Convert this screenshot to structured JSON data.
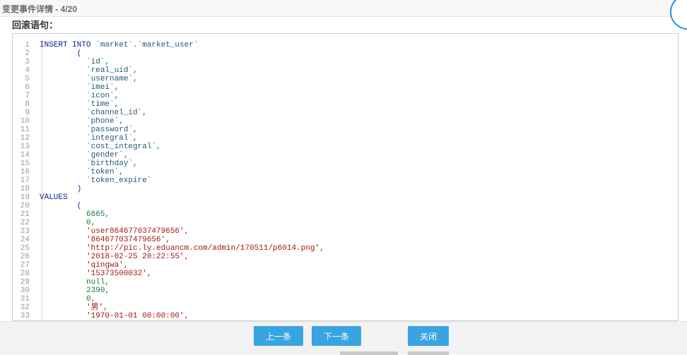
{
  "dialog": {
    "title": "变更事件详情 - 4/20",
    "section_label": "回滚语句："
  },
  "code": {
    "lines": [
      [
        {
          "t": "INSERT INTO ",
          "c": "kw"
        },
        {
          "t": "`market`.`market_user`",
          "c": "id"
        }
      ],
      [
        {
          "t": "        (",
          "c": "kw"
        }
      ],
      [
        {
          "t": "          `id`,",
          "c": "id"
        }
      ],
      [
        {
          "t": "          `real_uid`,",
          "c": "id"
        }
      ],
      [
        {
          "t": "          `username`,",
          "c": "id"
        }
      ],
      [
        {
          "t": "          `imei`,",
          "c": "id"
        }
      ],
      [
        {
          "t": "          `icon`,",
          "c": "id"
        }
      ],
      [
        {
          "t": "          `time`,",
          "c": "id"
        }
      ],
      [
        {
          "t": "          `channel_id`,",
          "c": "id"
        }
      ],
      [
        {
          "t": "          `phone`,",
          "c": "id"
        }
      ],
      [
        {
          "t": "          `password`,",
          "c": "id"
        }
      ],
      [
        {
          "t": "          `integral`,",
          "c": "id"
        }
      ],
      [
        {
          "t": "          `cost_integral`,",
          "c": "id"
        }
      ],
      [
        {
          "t": "          `gender`,",
          "c": "id"
        }
      ],
      [
        {
          "t": "          `birthday`,",
          "c": "id"
        }
      ],
      [
        {
          "t": "          `token`,",
          "c": "id"
        }
      ],
      [
        {
          "t": "          `token_expire`",
          "c": "id"
        }
      ],
      [
        {
          "t": "        )",
          "c": "kw"
        }
      ],
      [
        {
          "t": "VALUES",
          "c": "kw"
        }
      ],
      [
        {
          "t": "        (",
          "c": "kw"
        }
      ],
      [
        {
          "t": "          6865,",
          "c": "num"
        }
      ],
      [
        {
          "t": "          0,",
          "c": "num"
        }
      ],
      [
        {
          "t": "          'user864677037479656',",
          "c": "str"
        }
      ],
      [
        {
          "t": "          '864677037479656',",
          "c": "str"
        }
      ],
      [
        {
          "t": "          'http://pic.ly.eduancm.com/admin/170511/p6014.png',",
          "c": "str"
        }
      ],
      [
        {
          "t": "          '2018-02-25 20:22:55',",
          "c": "str"
        }
      ],
      [
        {
          "t": "          'qingwa',",
          "c": "str"
        }
      ],
      [
        {
          "t": "          '15373500032',",
          "c": "str"
        }
      ],
      [
        {
          "t": "          null,",
          "c": "num"
        }
      ],
      [
        {
          "t": "          2390,",
          "c": "num"
        }
      ],
      [
        {
          "t": "          0,",
          "c": "num"
        }
      ],
      [
        {
          "t": "          '男',",
          "c": "str"
        }
      ],
      [
        {
          "t": "          '1970-01-01 00:00:00',",
          "c": "str"
        }
      ]
    ]
  },
  "buttons": {
    "prev_label": "上一条",
    "next_label": "下一条",
    "close_label": "关闭"
  },
  "colors": {
    "accent": "#38a4e0",
    "keyword": "#0a1f9c",
    "identifier": "#1e5a7a",
    "number": "#1a7a3a",
    "string": "#a31515"
  }
}
